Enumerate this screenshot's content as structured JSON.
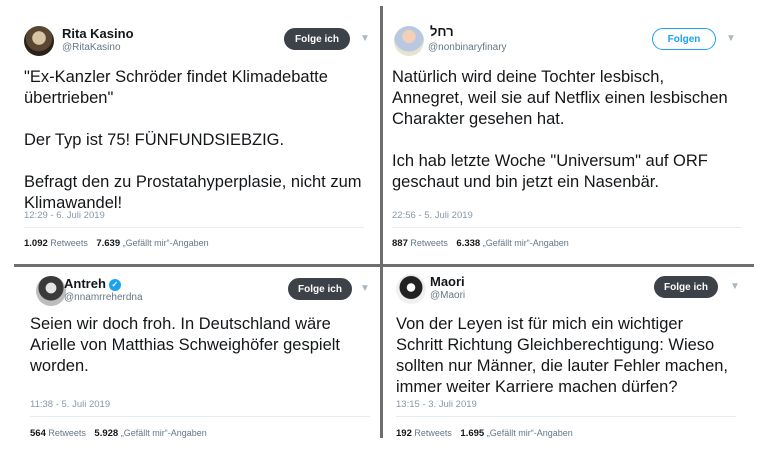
{
  "tweets": [
    {
      "name": "Rita Kasino",
      "handle": "@RitaKasino",
      "follow_label": "Folge ich",
      "paragraphs": [
        "\"Ex-Kanzler Schröder findet Klimadebatte\nübertrieben\"",
        "Der Typ ist 75! FÜNFUNDSIEBZIG.",
        "Befragt den zu Prostatahyperplasie, nicht zum\nKlimawandel!"
      ],
      "timestamp": "12:29 - 6. Juli 2019",
      "retweets": "1.092",
      "retweets_label": "Retweets",
      "likes": "7.639",
      "likes_label": "„Gefällt mir“-Angaben"
    },
    {
      "name": "רחל",
      "handle": "@nonbinaryfinary",
      "follow_label": "Folgen",
      "paragraphs": [
        "Natürlich wird deine Tochter lesbisch,\nAnnegret, weil sie auf Netflix einen lesbischen\nCharakter gesehen hat.",
        "Ich hab letzte Woche \"Universum\" auf ORF\ngeschaut und bin jetzt ein Nasenbär."
      ],
      "timestamp": "22:56 - 5. Juli 2019",
      "retweets": "887",
      "retweets_label": "Retweets",
      "likes": "6.338",
      "likes_label": "„Gefällt mir“-Angaben"
    },
    {
      "name": "Antreh",
      "handle": "@nnamrreherdna",
      "follow_label": "Folge ich",
      "paragraphs": [
        "Seien wir doch froh. In Deutschland wäre\nArielle von Matthias Schweighöfer gespielt\nworden."
      ],
      "timestamp": "11:38 - 5. Juli 2019",
      "retweets": "564",
      "retweets_label": "Retweets",
      "likes": "5.928",
      "likes_label": "„Gefällt mir“-Angaben"
    },
    {
      "name": "Maori",
      "handle": "@Maori",
      "follow_label": "Folge ich",
      "paragraphs": [
        "Von der Leyen ist für mich ein wichtiger\nSchritt Richtung Gleichberechtigung: Wieso\nsollten nur Männer, die lauter Fehler machen,\nimmer weiter Karriere machen dürfen?"
      ],
      "timestamp": "13:15 - 3. Juli 2019",
      "retweets": "192",
      "retweets_label": "Retweets",
      "likes": "1.695",
      "likes_label": "„Gefällt mir“-Angaben"
    }
  ],
  "colors": {
    "follow_dark": "#3d4148",
    "follow_light_border": "#1da1f2",
    "verified": "#1da1f2",
    "divider": "#6e6e6e"
  },
  "icons": {
    "chevron": "chevron-down-icon",
    "verified": "verified-badge-icon"
  }
}
